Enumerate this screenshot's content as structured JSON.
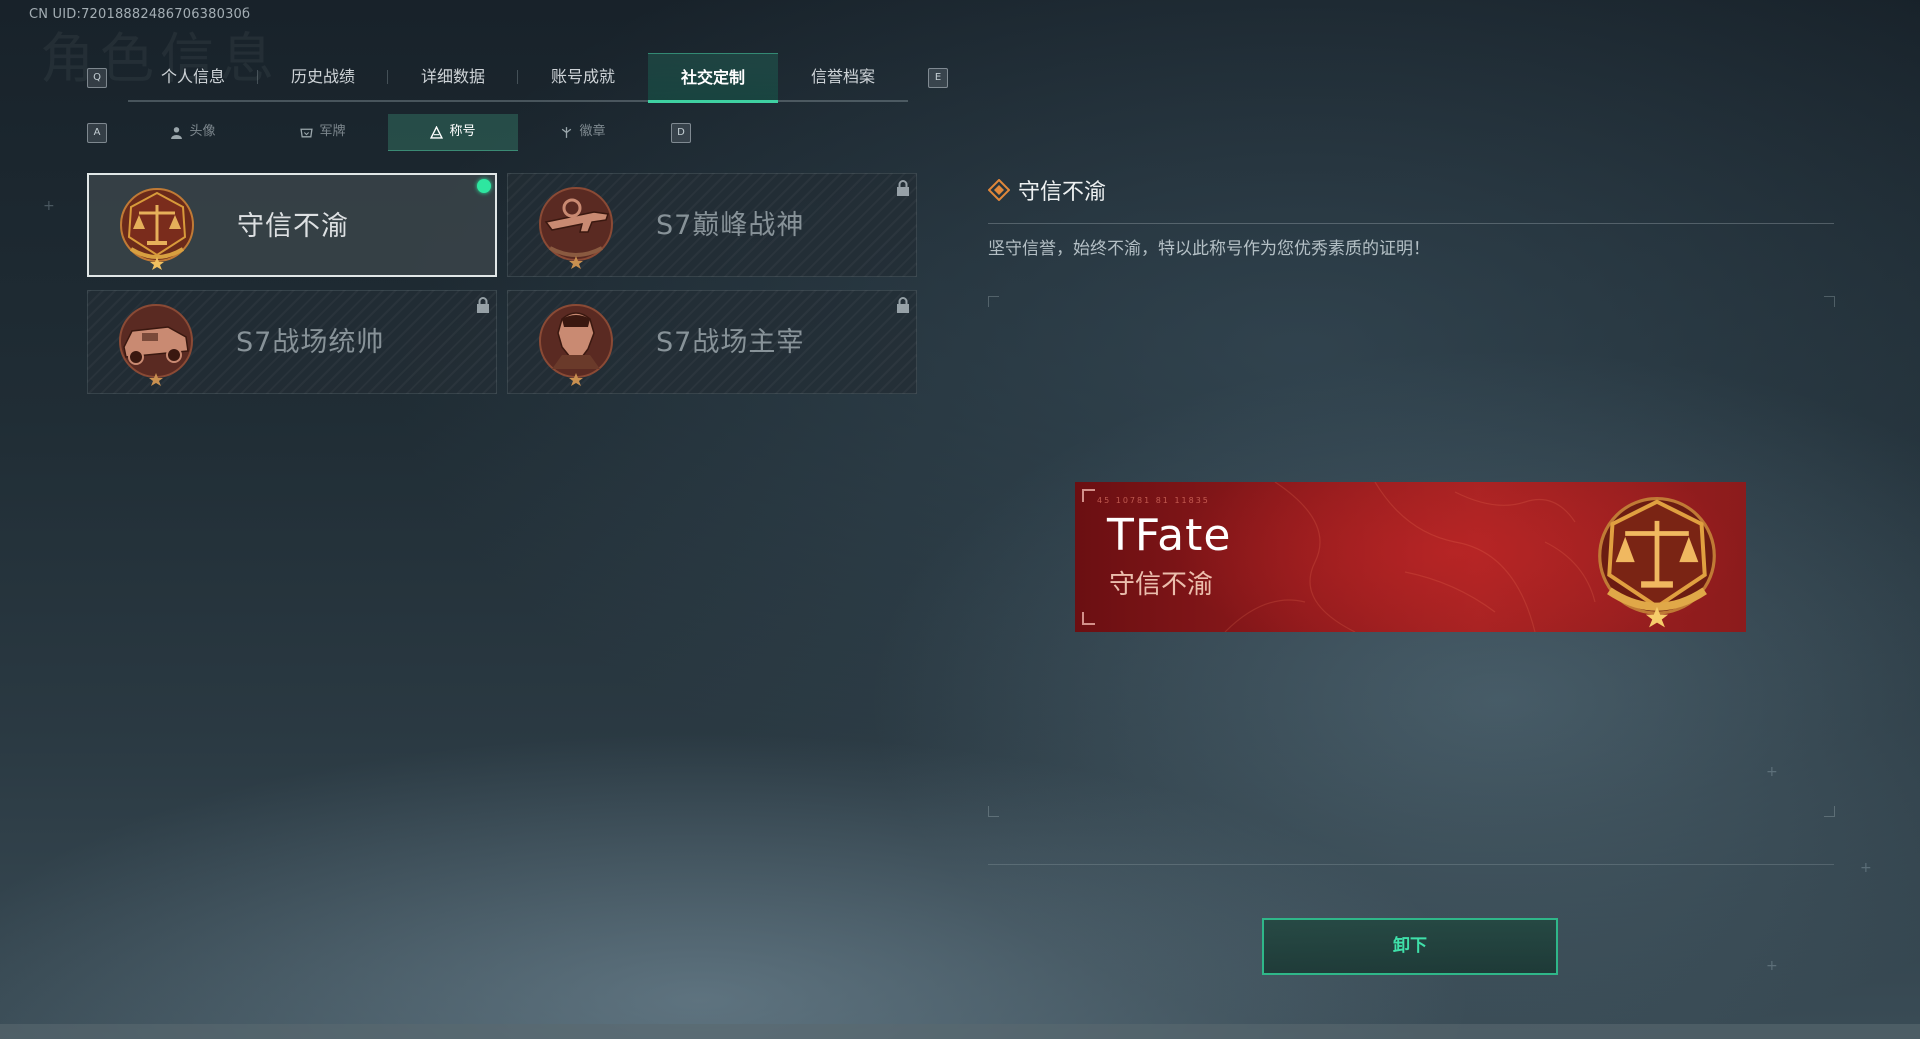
{
  "header": {
    "uid": "CN UID:7201888248670638030б",
    "watermark": "角色信息"
  },
  "keys": {
    "prev_main": "Q",
    "next_main": "E",
    "prev_sub": "A",
    "next_sub": "D"
  },
  "main_tabs": [
    {
      "label": "个人信息",
      "active": false
    },
    {
      "label": "历史战绩",
      "active": false
    },
    {
      "label": "详细数据",
      "active": false
    },
    {
      "label": "账号成就",
      "active": false
    },
    {
      "label": "社交定制",
      "active": true
    },
    {
      "label": "信誉档案",
      "active": false
    }
  ],
  "sub_tabs": [
    {
      "label": "头像",
      "icon": "person-icon",
      "active": false
    },
    {
      "label": "军牌",
      "icon": "dogtag-icon",
      "active": false
    },
    {
      "label": "称号",
      "icon": "title-icon",
      "active": true
    },
    {
      "label": "徽章",
      "icon": "badge-icon",
      "active": false
    }
  ],
  "cards": [
    {
      "label": "守信不渝",
      "emblem": "scales-emblem-icon",
      "selected": true,
      "locked": false,
      "equipped": true
    },
    {
      "label": "S7巅峰战神",
      "emblem": "rifle-emblem-icon",
      "selected": false,
      "locked": true,
      "equipped": false
    },
    {
      "label": "S7战场统帅",
      "emblem": "vehicle-emblem-icon",
      "selected": false,
      "locked": true,
      "equipped": false
    },
    {
      "label": "S7战场主宰",
      "emblem": "soldier-emblem-icon",
      "selected": false,
      "locked": true,
      "equipped": false
    }
  ],
  "detail": {
    "title": "守信不渝",
    "description": "坚守信誉，始终不渝，特以此称号作为您优秀素质的证明！"
  },
  "banner": {
    "player_name": "TFate",
    "title": "守信不渝",
    "code": "45 10781 81 11835",
    "emblem": "scales-emblem-icon"
  },
  "action": {
    "button_label": "卸下"
  },
  "colors": {
    "accent": "#3fd1a2",
    "equipped_dot": "#2ee6a0",
    "banner_red": "#a32222",
    "emblem_gold": "#d89a3a"
  }
}
